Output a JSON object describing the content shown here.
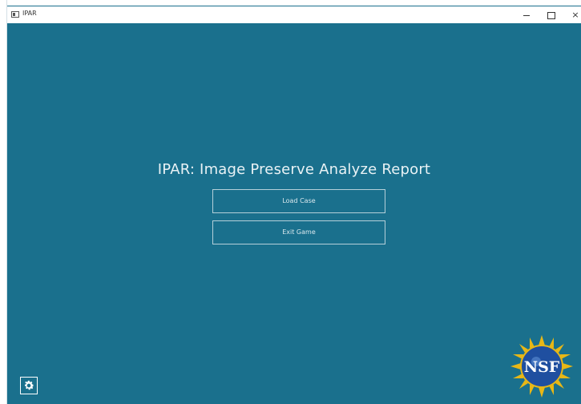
{
  "window": {
    "title": "IPAR",
    "controls": {
      "minimize": "–",
      "maximize": "□",
      "close": "×"
    }
  },
  "main": {
    "title": "IPAR: Image Preserve Analyze Report",
    "buttons": [
      {
        "label": "Load Case"
      },
      {
        "label": "Exit Game"
      }
    ]
  },
  "footer": {
    "settings_icon": "gear-icon",
    "logo": {
      "icon": "nsf-logo",
      "text": "NSF"
    }
  },
  "colors": {
    "background": "#1a708d",
    "text": "#e9f2f5",
    "button_border": "#b5d0d9",
    "logo_blue": "#1f4fa0",
    "logo_gold": "#e8b716"
  }
}
